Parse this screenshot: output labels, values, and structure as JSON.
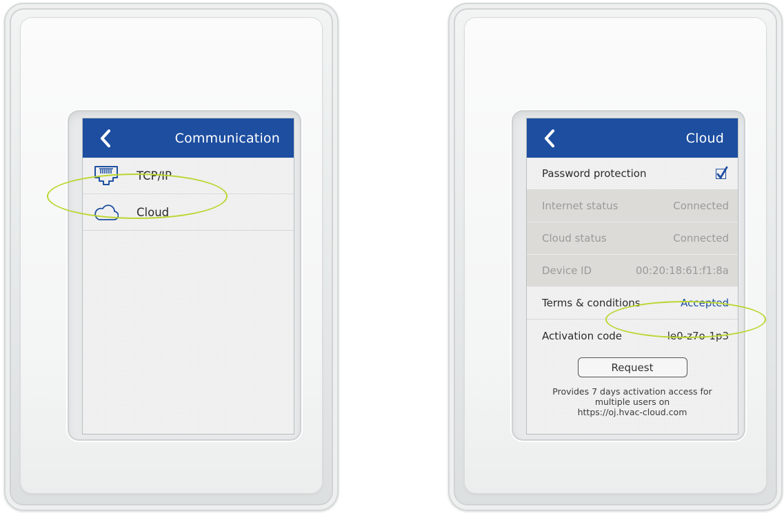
{
  "left_screen": {
    "title": "Communication",
    "items": [
      {
        "label": "TCP/IP",
        "icon": "ethernet-port-icon"
      },
      {
        "label": "Cloud",
        "icon": "cloud-icon"
      }
    ]
  },
  "right_screen": {
    "title": "Cloud",
    "password_protection": {
      "label": "Password protection",
      "checked": true
    },
    "internet_status": {
      "label": "Internet status",
      "value": "Connected"
    },
    "cloud_status": {
      "label": "Cloud status",
      "value": "Connected"
    },
    "device_id": {
      "label": "Device ID",
      "value": "00:20:18:61:f1:8a"
    },
    "terms": {
      "label": "Terms & conditions",
      "value": "Accepted"
    },
    "activation_code": {
      "label": "Activation code",
      "value": "le0-z7o-1p3"
    },
    "request_button": "Request",
    "info_lines": [
      "Provides 7 days activation access for",
      "multiple users on",
      "https://oj.hvac-cloud.com"
    ]
  },
  "colors": {
    "header_blue": "#1d4ea0",
    "highlight_ellipse": "#bcd530",
    "disabled_row": "#dcdbd7"
  }
}
